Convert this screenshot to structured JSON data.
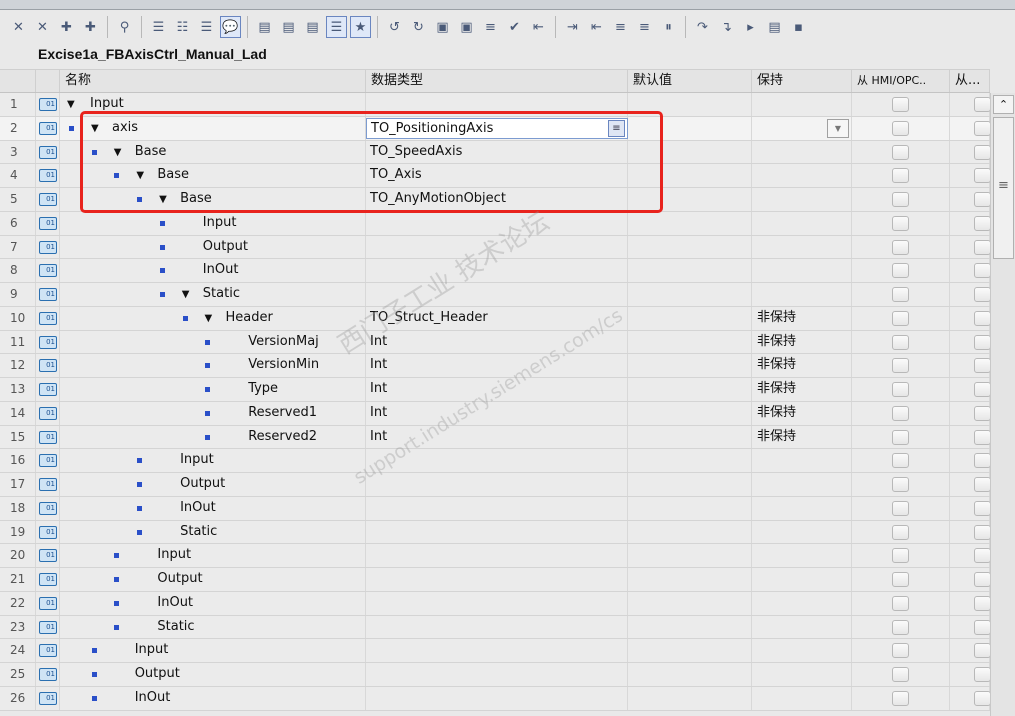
{
  "toolbar": {
    "icons": [
      "insert-row",
      "delete-row",
      "add-new-row",
      "add-new-row-below",
      "find",
      "expand-all",
      "collapse-all",
      "show-structure",
      "comment",
      "interface-down",
      "monitor-down",
      "block-down",
      "list-view",
      "favorites",
      "reset-start",
      "reset-values",
      "snapshot",
      "load-snapshot",
      "copy-values",
      "apply-values",
      "keep-actual",
      "indent-in",
      "indent-out",
      "insert-network",
      "network-down",
      "network-up",
      "breakpoint",
      "step-over",
      "step-into",
      "more",
      "settings"
    ]
  },
  "title": "Excise1a_FBAxisCtrl_Manual_Lad",
  "columns": [
    "名称",
    "数据类型",
    "默认值",
    "保持",
    "从 HMI/OPC..",
    "从..."
  ],
  "rows": [
    {
      "n": "1",
      "name": "Input",
      "level": -1,
      "expand": true,
      "type": "",
      "retain": ""
    },
    {
      "n": "2",
      "name": "axis",
      "level": 0,
      "expand": true,
      "type": "TO_PositioningAxis",
      "retain": "",
      "editing": true
    },
    {
      "n": "3",
      "name": "Base",
      "level": 1,
      "expand": true,
      "type": "TO_SpeedAxis",
      "retain": ""
    },
    {
      "n": "4",
      "name": "Base",
      "level": 2,
      "expand": true,
      "type": "TO_Axis",
      "retain": ""
    },
    {
      "n": "5",
      "name": "Base",
      "level": 3,
      "expand": true,
      "type": "TO_AnyMotionObject",
      "retain": ""
    },
    {
      "n": "6",
      "name": "Input",
      "level": 4,
      "expand": false,
      "type": "",
      "retain": ""
    },
    {
      "n": "7",
      "name": "Output",
      "level": 4,
      "expand": false,
      "type": "",
      "retain": ""
    },
    {
      "n": "8",
      "name": "InOut",
      "level": 4,
      "expand": false,
      "type": "",
      "retain": ""
    },
    {
      "n": "9",
      "name": "Static",
      "level": 4,
      "expand": true,
      "type": "",
      "retain": ""
    },
    {
      "n": "10",
      "name": "Header",
      "level": 5,
      "expand": true,
      "type": "TO_Struct_Header",
      "retain": "非保持"
    },
    {
      "n": "11",
      "name": "VersionMaj",
      "level": 6,
      "expand": false,
      "type": "Int",
      "retain": "非保持"
    },
    {
      "n": "12",
      "name": "VersionMin",
      "level": 6,
      "expand": false,
      "type": "Int",
      "retain": "非保持"
    },
    {
      "n": "13",
      "name": "Type",
      "level": 6,
      "expand": false,
      "type": "Int",
      "retain": "非保持"
    },
    {
      "n": "14",
      "name": "Reserved1",
      "level": 6,
      "expand": false,
      "type": "Int",
      "retain": "非保持"
    },
    {
      "n": "15",
      "name": "Reserved2",
      "level": 6,
      "expand": false,
      "type": "Int",
      "retain": "非保持"
    },
    {
      "n": "16",
      "name": "Input",
      "level": 3,
      "expand": false,
      "type": "",
      "retain": ""
    },
    {
      "n": "17",
      "name": "Output",
      "level": 3,
      "expand": false,
      "type": "",
      "retain": ""
    },
    {
      "n": "18",
      "name": "InOut",
      "level": 3,
      "expand": false,
      "type": "",
      "retain": ""
    },
    {
      "n": "19",
      "name": "Static",
      "level": 3,
      "expand": false,
      "type": "",
      "retain": ""
    },
    {
      "n": "20",
      "name": "Input",
      "level": 2,
      "expand": false,
      "type": "",
      "retain": ""
    },
    {
      "n": "21",
      "name": "Output",
      "level": 2,
      "expand": false,
      "type": "",
      "retain": ""
    },
    {
      "n": "22",
      "name": "InOut",
      "level": 2,
      "expand": false,
      "type": "",
      "retain": ""
    },
    {
      "n": "23",
      "name": "Static",
      "level": 2,
      "expand": false,
      "type": "",
      "retain": ""
    },
    {
      "n": "24",
      "name": "Input",
      "level": 1,
      "expand": false,
      "type": "",
      "retain": ""
    },
    {
      "n": "25",
      "name": "Output",
      "level": 1,
      "expand": false,
      "type": "",
      "retain": ""
    },
    {
      "n": "26",
      "name": "InOut",
      "level": 1,
      "expand": false,
      "type": "",
      "retain": ""
    }
  ],
  "watermark": {
    "line1": "西门子工业  技术论坛",
    "line2": "support.industry.siemens.com/cs"
  },
  "colors": {
    "highlight": "#e8231d",
    "bullet": "#2a4fc8"
  }
}
